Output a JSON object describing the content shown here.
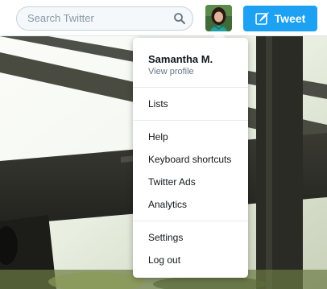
{
  "search": {
    "placeholder": "Search Twitter",
    "icon": "search-icon"
  },
  "header": {
    "avatar_alt": "profile-avatar",
    "tweet_label": "Tweet",
    "tweet_icon": "quill-icon"
  },
  "colors": {
    "accent": "#1da1f2",
    "text": "#14171a",
    "muted": "#657786"
  },
  "menu": {
    "profile_name": "Samantha M.",
    "profile_link": "View profile",
    "groups": [
      [
        "Lists"
      ],
      [
        "Help",
        "Keyboard shortcuts",
        "Twitter Ads",
        "Analytics"
      ],
      [
        "Settings",
        "Log out"
      ]
    ],
    "items": [
      "Lists",
      "Help",
      "Keyboard shortcuts",
      "Twitter Ads",
      "Analytics",
      "Settings",
      "Log out"
    ]
  }
}
